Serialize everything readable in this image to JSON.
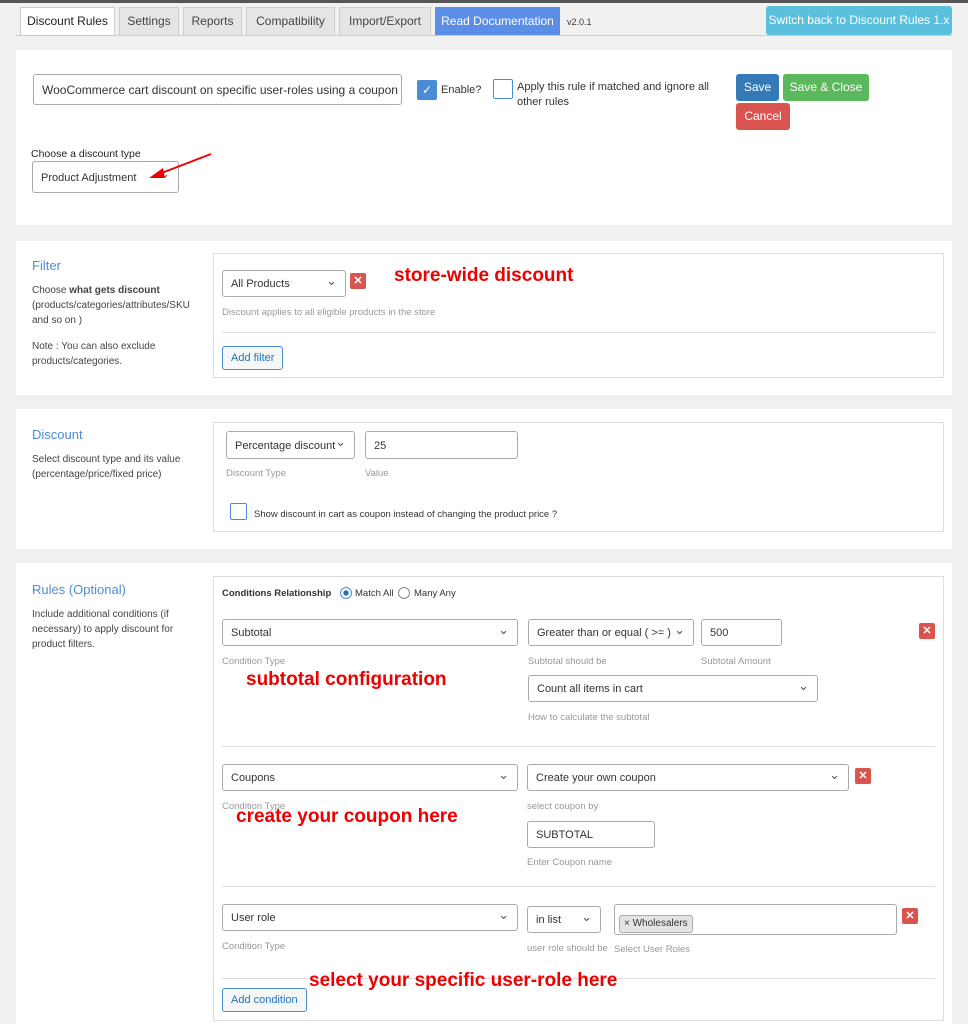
{
  "tabs": [
    "Discount Rules",
    "Settings",
    "Reports",
    "Compatibility",
    "Import/Export",
    "Read Documentation"
  ],
  "version": "v2.0.1",
  "switch_back": "Switch back to Discount Rules 1.x",
  "rule": {
    "name": "WooCommerce cart discount on specific user-roles using a coupon",
    "enable_label": "Enable?",
    "enabled": true,
    "exclusive_label": "Apply this rule if matched and ignore all other rules",
    "exclusive": false,
    "save": "Save",
    "save_close": "Save & Close",
    "cancel": "Cancel",
    "discount_type_label": "Choose a discount type",
    "discount_type": "Product Adjustment"
  },
  "filter": {
    "title": "Filter",
    "desc_pre": "Choose ",
    "desc_bold": "what gets discount",
    "desc_post": " (products/categories/attributes/SKU and so on )",
    "note": "Note : You can also exclude products/categories.",
    "selected": "All Products",
    "hint": "Discount applies to all eligible products in the store",
    "add": "Add filter",
    "annotation": "store-wide discount"
  },
  "discount": {
    "title": "Discount",
    "desc": "Select discount type and its value (percentage/price/fixed price)",
    "type": "Percentage discount",
    "type_label": "Discount Type",
    "value": "25",
    "value_label": "Value",
    "coupon_label": "Show discount in cart as coupon instead of changing the product price ?"
  },
  "rules": {
    "title": "Rules (Optional)",
    "desc": "Include additional conditions (if necessary) to apply discount for product filters.",
    "relationship_label": "Conditions Relationship",
    "match_all": "Match All",
    "match_any": "Many Any",
    "subtotal": {
      "type": "Subtotal",
      "type_label": "Condition Type",
      "operator": "Greater than or equal ( >= )",
      "operator_label": "Subtotal should be",
      "amount": "500",
      "amount_label": "Subtotal Amount",
      "calc": "Count all items in cart",
      "calc_label": "How to calculate the subtotal",
      "annotation": "subtotal configuration"
    },
    "coupons": {
      "type": "Coupons",
      "type_label": "Condition Type",
      "by": "Create your own coupon",
      "by_label": "select coupon by",
      "name": "SUBTOTAL",
      "name_label": "Enter Coupon name",
      "annotation": "create your coupon here"
    },
    "user_role": {
      "type": "User role",
      "type_label": "Condition Type",
      "op": "in list",
      "op_label": "user role should be",
      "tag": "× Wholesalers",
      "roles_label": "Select User Roles",
      "annotation": "select your specific user-role here"
    },
    "add": "Add condition"
  },
  "colors": {
    "primary": "#337ab7",
    "success": "#5cb85c",
    "danger": "#d9534f",
    "info": "#5bc0de",
    "annotation": "#ee0000"
  }
}
